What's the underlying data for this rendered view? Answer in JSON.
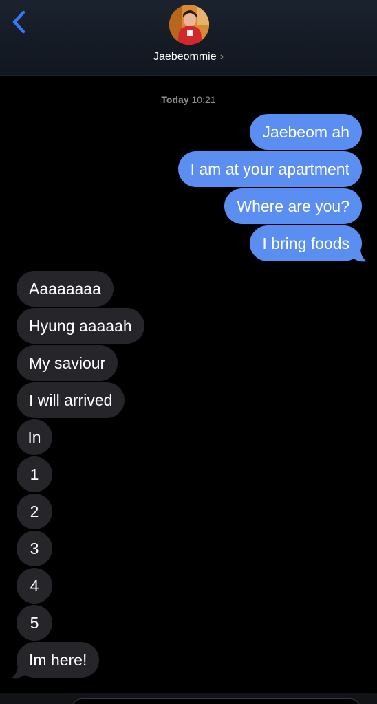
{
  "header": {
    "contact_name": "Jaebeommie",
    "chevron": "›",
    "back_icon": "chevron-left-icon",
    "accent_color": "#3478f6"
  },
  "timestamp": {
    "day": "Today",
    "time": "10:21"
  },
  "colors": {
    "outgoing_bubble": "#5a8ef0",
    "incoming_bubble": "#26252a",
    "background": "#000000"
  },
  "messages": {
    "outgoing": [
      "Jaebeom ah",
      "I am at your apartment",
      "Where are you?",
      "I bring foods"
    ],
    "incoming": [
      "Aaaaaaaa",
      "Hyung aaaaah",
      "My saviour",
      "I will arrived",
      "In",
      "1",
      "2",
      "3",
      "4",
      "5",
      "Im here!"
    ]
  }
}
